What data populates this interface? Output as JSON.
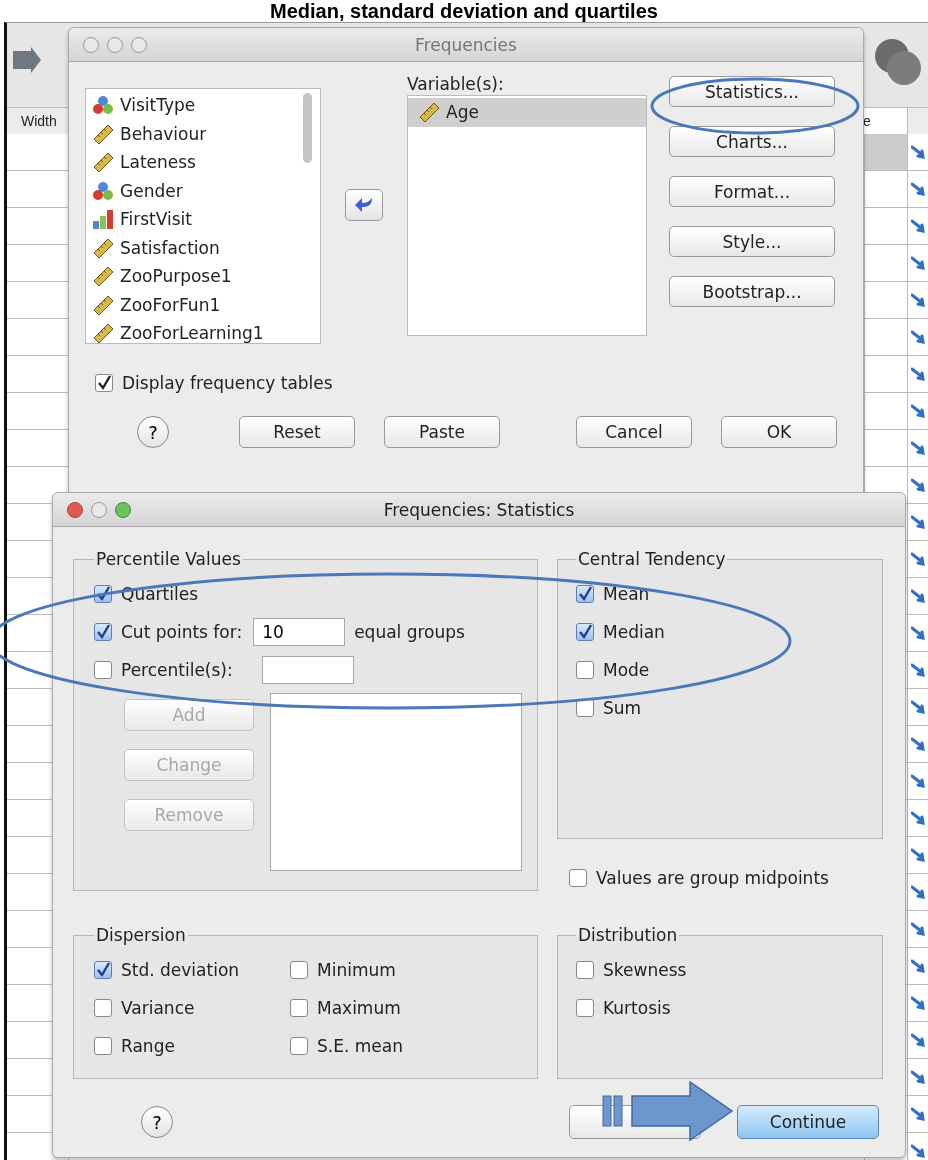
{
  "heading": "Median, standard deviation and quartiles",
  "sheet": {
    "left_header": "Width",
    "right_header": "e"
  },
  "frequencies": {
    "title": "Frequencies",
    "variables_label": "Variable(s):",
    "source_variables": [
      {
        "name": "VisitType",
        "kind": "nominal"
      },
      {
        "name": "Behaviour",
        "kind": "scale"
      },
      {
        "name": "Lateness",
        "kind": "scale"
      },
      {
        "name": "Gender",
        "kind": "nominal"
      },
      {
        "name": "FirstVisit",
        "kind": "ordinal"
      },
      {
        "name": "Satisfaction",
        "kind": "scale"
      },
      {
        "name": "ZooPurpose1",
        "kind": "scale"
      },
      {
        "name": "ZooForFun1",
        "kind": "scale"
      },
      {
        "name": "ZooForLearning1",
        "kind": "scale"
      }
    ],
    "selected_variables": [
      {
        "name": "Age",
        "kind": "scale",
        "selected": true
      }
    ],
    "side_buttons": [
      "Statistics...",
      "Charts...",
      "Format...",
      "Style...",
      "Bootstrap..."
    ],
    "display_frequency_tables": {
      "label": "Display frequency tables",
      "checked": true
    },
    "help": "?",
    "buttons": [
      "Reset",
      "Paste",
      "Cancel",
      "OK"
    ]
  },
  "statistics": {
    "title": "Frequencies: Statistics",
    "percentile_values": {
      "title": "Percentile Values",
      "quartiles": {
        "label": "Quartiles",
        "checked": true
      },
      "cut_points": {
        "label": "Cut points for:",
        "checked": true,
        "value": "10",
        "suffix": "equal groups"
      },
      "percentiles": {
        "label": "Percentile(s):",
        "checked": false
      },
      "buttons": [
        {
          "label": "Add",
          "disabled": true
        },
        {
          "label": "Change",
          "disabled": true
        },
        {
          "label": "Remove",
          "disabled": true
        }
      ]
    },
    "central_tendency": {
      "title": "Central Tendency",
      "items": [
        {
          "label": "Mean",
          "checked": true
        },
        {
          "label": "Median",
          "checked": true
        },
        {
          "label": "Mode",
          "checked": false
        },
        {
          "label": "Sum",
          "checked": false
        }
      ]
    },
    "group_midpoints": {
      "label": "Values are group midpoints",
      "checked": false
    },
    "dispersion": {
      "title": "Dispersion",
      "items": [
        {
          "label": "Std. deviation",
          "checked": true
        },
        {
          "label": "Minimum",
          "checked": false
        },
        {
          "label": "Variance",
          "checked": false
        },
        {
          "label": "Maximum",
          "checked": false
        },
        {
          "label": "Range",
          "checked": false
        },
        {
          "label": "S.E. mean",
          "checked": false
        }
      ]
    },
    "distribution": {
      "title": "Distribution",
      "items": [
        {
          "label": "Skewness",
          "checked": false
        },
        {
          "label": "Kurtosis",
          "checked": false
        }
      ]
    },
    "help": "?",
    "continue": "Continue"
  }
}
